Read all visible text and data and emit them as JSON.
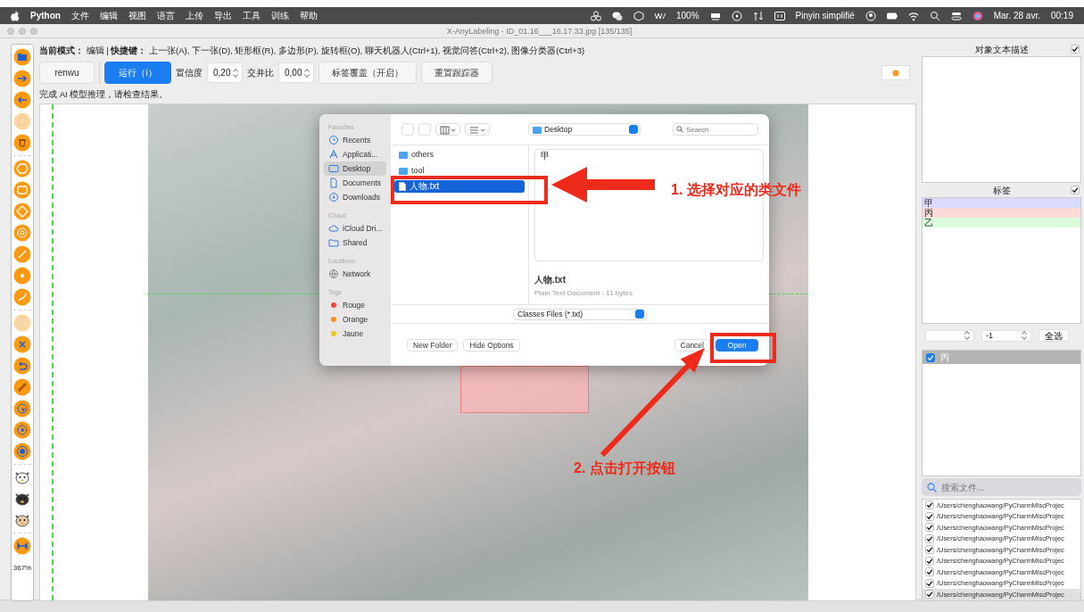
{
  "menu_bar": {
    "app_name": "Python",
    "menus": [
      "文件",
      "编辑",
      "视图",
      "语言",
      "上传",
      "导出",
      "工具",
      "训练",
      "帮助"
    ],
    "battery": "100%",
    "input_source": "Pinyin simplifié",
    "date": "Mar. 28 avr.",
    "time": "00:19"
  },
  "window": {
    "title": "X-AnyLabeling - ID_01.16___16.17.33.jpg [135/135]"
  },
  "tools": {
    "groups": [
      [
        {
          "kind": "open",
          "disabled": false
        },
        {
          "kind": "next",
          "disabled": false
        },
        {
          "kind": "prev",
          "disabled": false
        },
        {
          "kind": "save",
          "disabled": true
        },
        {
          "kind": "delete",
          "disabled": false
        }
      ],
      [
        {
          "kind": "polygon",
          "disabled": false
        },
        {
          "kind": "rectangle",
          "disabled": false
        },
        {
          "kind": "rotation",
          "disabled": false
        },
        {
          "kind": "circle",
          "disabled": false
        },
        {
          "kind": "line",
          "disabled": false
        },
        {
          "kind": "point",
          "disabled": false
        },
        {
          "kind": "linestrip",
          "disabled": false
        }
      ],
      [
        {
          "kind": "edit",
          "disabled": true
        },
        {
          "kind": "close",
          "disabled": false
        },
        {
          "kind": "undo",
          "disabled": false
        },
        {
          "kind": "brush",
          "disabled": false
        },
        {
          "kind": "cursor",
          "disabled": false
        },
        {
          "kind": "play",
          "disabled": false
        },
        {
          "kind": "ai",
          "disabled": false
        }
      ],
      [
        {
          "kind": "bear",
          "disabled": false
        },
        {
          "kind": "dog",
          "disabled": false
        },
        {
          "kind": "cat",
          "disabled": false
        }
      ],
      [
        {
          "kind": "fit",
          "disabled": false
        }
      ]
    ],
    "zoom": "367%"
  },
  "header": {
    "mode_line": "**当前模式：** 编辑 | **快捷键：** 上一张(A), 下一张(D), 矩形框(R), 多边形(P), 旋转框(O), 聊天机器人(Ctrl+1), 视觉问答(Ctrl+2), 图像分类器(Ctrl+3)",
    "status": "完成 AI 模型推理，请检查结果。"
  },
  "toolbar": {
    "model_button": "renwu",
    "run_button": "运行（i）",
    "confidence_label": "置信度",
    "confidence": "0,20",
    "iou_label": "交并比",
    "iou": "0,00",
    "overlay_button": "标签覆盖（开启）",
    "reset_button": "重置跟踪器"
  },
  "dialog": {
    "location": "Desktop",
    "search_placeholder": "Search",
    "sidebar": [
      {
        "heading": "Favorites",
        "items": [
          {
            "kind": "recents",
            "label": "Recents",
            "selected": false
          },
          {
            "kind": "apps",
            "label": "Applicati...",
            "selected": false
          },
          {
            "kind": "desktop",
            "label": "Desktop",
            "selected": true
          },
          {
            "kind": "documents",
            "label": "Documents",
            "selected": false
          },
          {
            "kind": "downloads",
            "label": "Downloads",
            "selected": false
          }
        ]
      },
      {
        "heading": "iCloud",
        "items": [
          {
            "kind": "icloud",
            "label": "iCloud Dri...",
            "selected": false
          },
          {
            "kind": "shared",
            "label": "Shared",
            "selected": false
          }
        ]
      },
      {
        "heading": "Locations",
        "items": [
          {
            "kind": "network",
            "label": "Network",
            "selected": false
          }
        ]
      },
      {
        "heading": "Tags",
        "items": [
          {
            "kind": "tag",
            "label": "Rouge",
            "color": "#f0453a",
            "selected": false
          },
          {
            "kind": "tag",
            "label": "Orange",
            "color": "#f5921e",
            "selected": false
          },
          {
            "kind": "tag",
            "label": "Jaune",
            "color": "#f2c318",
            "selected": false
          }
        ]
      }
    ],
    "files": [
      {
        "kind": "folder",
        "name": "others",
        "selected": false
      },
      {
        "kind": "folder",
        "name": "tool",
        "selected": false
      },
      {
        "kind": "file",
        "name": "人物.txt",
        "selected": true
      }
    ],
    "preview": {
      "content": "甲",
      "name": "人物.txt",
      "info": "Plain Text Document - 11 bytes"
    },
    "filter": "Classes Files (*.txt)",
    "buttons": {
      "new_folder": "New Folder",
      "hide_options": "Hide Options",
      "cancel": "Cancel",
      "open": "Open"
    }
  },
  "annotations": {
    "step1": "1. 选择对应的类文件",
    "step2": "2. 点击打开按钮"
  },
  "right_panel": {
    "description": {
      "title": "对象文本描述",
      "checked": true
    },
    "labels": {
      "title": "标签",
      "checked": true,
      "items": [
        {
          "name": "甲",
          "color": "#dadafc"
        },
        {
          "name": "丙",
          "color": "#fcdada"
        },
        {
          "name": "乙",
          "color": "#dafcda"
        }
      ]
    },
    "group_id": "-1",
    "select_all": "全选",
    "shapes": [
      {
        "name": "丙",
        "checked": true,
        "selected": true
      }
    ],
    "file_search_placeholder": "搜索文件...",
    "files": [
      {
        "path": "/Users/chenghaowang/PyCharmMiscProjec",
        "checked": true,
        "selected": false
      },
      {
        "path": "/Users/chenghaowang/PyCharmMiscProjec",
        "checked": true,
        "selected": false
      },
      {
        "path": "/Users/chenghaowang/PyCharmMiscProjec",
        "checked": true,
        "selected": false
      },
      {
        "path": "/Users/chenghaowang/PyCharmMiscProjec",
        "checked": true,
        "selected": false
      },
      {
        "path": "/Users/chenghaowang/PyCharmMiscProjec",
        "checked": true,
        "selected": false
      },
      {
        "path": "/Users/chenghaowang/PyCharmMiscProjec",
        "checked": true,
        "selected": false
      },
      {
        "path": "/Users/chenghaowang/PyCharmMiscProjec",
        "checked": true,
        "selected": false
      },
      {
        "path": "/Users/chenghaowang/PyCharmMiscProjec",
        "checked": true,
        "selected": false
      },
      {
        "path": "/Users/chenghaowang/PyCharmMiscProjec",
        "checked": true,
        "selected": true
      }
    ]
  }
}
